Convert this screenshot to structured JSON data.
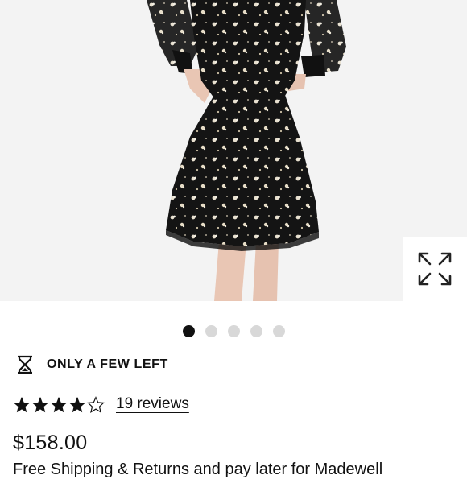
{
  "product": {
    "image_alt": "Black floral mini dress",
    "carousel": {
      "total": 5,
      "active_index": 0
    },
    "stock_label": "ONLY A FEW LEFT",
    "rating": {
      "value": 4,
      "max": 5
    },
    "reviews_label": "19 reviews",
    "price": "$158.00",
    "description_partial": "Free Shipping & Returns and pay later for Madewell"
  },
  "colors": {
    "text": "#111111",
    "dot_inactive": "#d8d8d8",
    "dot_active": "#111111",
    "dress": "#141414",
    "background": "#f3f3f3"
  },
  "icons": {
    "expand": "expand-arrows-icon",
    "stock": "hourglass-icon",
    "star": "star-icon"
  }
}
